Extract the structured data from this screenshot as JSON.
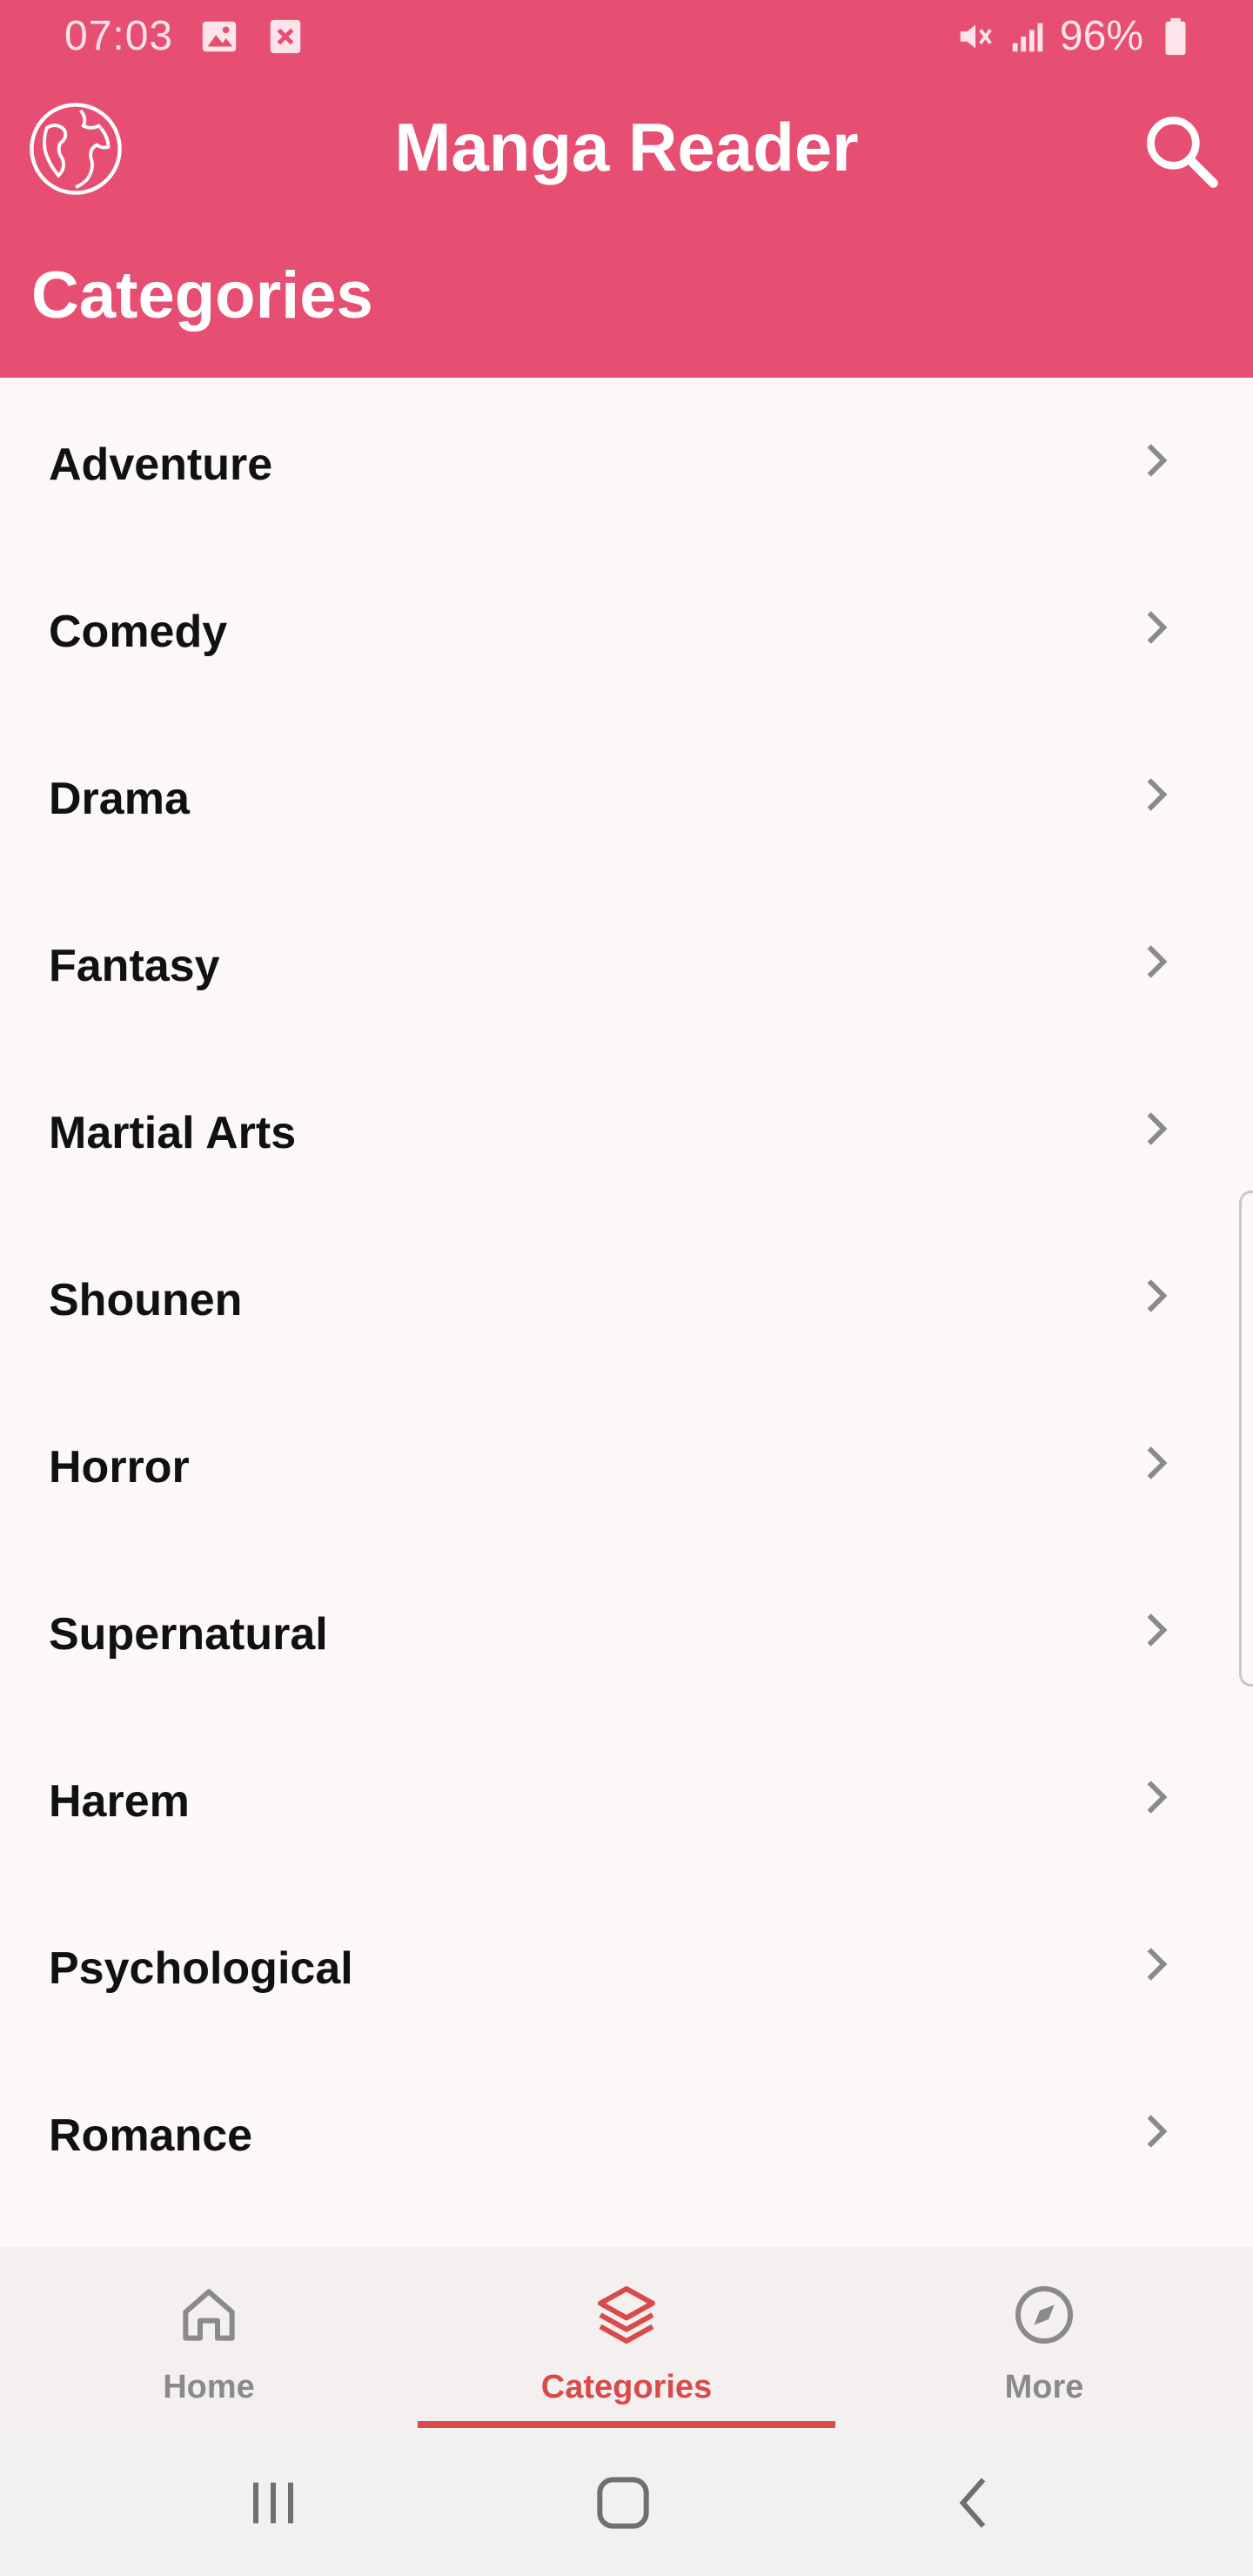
{
  "status_bar": {
    "time": "07:03",
    "battery_text": "96%",
    "icons": [
      "image-notification-icon",
      "close-notification-icon",
      "mute-icon",
      "signal-icon",
      "battery-icon"
    ]
  },
  "app_bar": {
    "title": "Manga Reader",
    "left_icon": "globe-icon",
    "right_icon": "search-icon"
  },
  "section": {
    "title": "Categories"
  },
  "categories": [
    {
      "label": "Adventure"
    },
    {
      "label": "Comedy"
    },
    {
      "label": "Drama"
    },
    {
      "label": "Fantasy"
    },
    {
      "label": "Martial Arts"
    },
    {
      "label": "Shounen"
    },
    {
      "label": "Horror"
    },
    {
      "label": "Supernatural"
    },
    {
      "label": "Harem"
    },
    {
      "label": "Psychological"
    },
    {
      "label": "Romance"
    }
  ],
  "bottom_nav": {
    "tabs": [
      {
        "label": "Home",
        "icon": "home-icon",
        "active": false
      },
      {
        "label": "Categories",
        "icon": "layers-icon",
        "active": true
      },
      {
        "label": "More",
        "icon": "compass-icon",
        "active": false
      }
    ]
  },
  "colors": {
    "header": "#e64f72",
    "active_tab": "#d94b4b",
    "inactive_tab": "#8a8a8a",
    "list_background": "#fcf8f8"
  }
}
